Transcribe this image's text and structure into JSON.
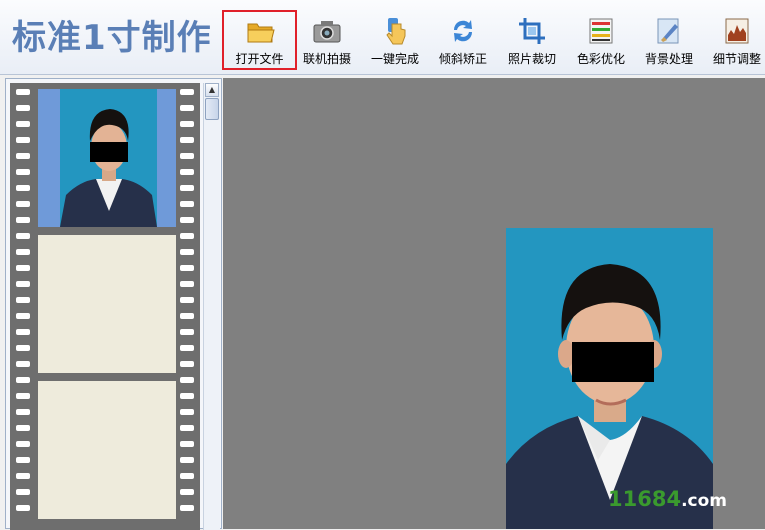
{
  "app": {
    "title": "标准1寸制作"
  },
  "toolbar": {
    "buttons": [
      {
        "label": "打开文件",
        "icon": "folder-open-icon",
        "highlighted": true
      },
      {
        "label": "联机拍摄",
        "icon": "camera-icon"
      },
      {
        "label": "一键完成",
        "icon": "hand-pointer-icon"
      },
      {
        "label": "倾斜矫正",
        "icon": "rotate-arrows-icon"
      },
      {
        "label": "照片裁切",
        "icon": "crop-icon"
      },
      {
        "label": "色彩优化",
        "icon": "color-sliders-icon"
      },
      {
        "label": "背景处理",
        "icon": "brush-icon"
      },
      {
        "label": "细节调整",
        "icon": "histogram-icon"
      }
    ]
  },
  "thumbnails": [
    {
      "state": "photo"
    },
    {
      "state": "empty"
    },
    {
      "state": "empty"
    }
  ],
  "watermark": {
    "brand": "11684",
    "domain": ".com"
  },
  "colors": {
    "title": "#5a7fb6",
    "highlight_border": "#e0202a",
    "photo_background": "#2396c0",
    "canvas": "#808080",
    "film": "#6e6e6e",
    "frame_empty": "#eeebdc"
  }
}
